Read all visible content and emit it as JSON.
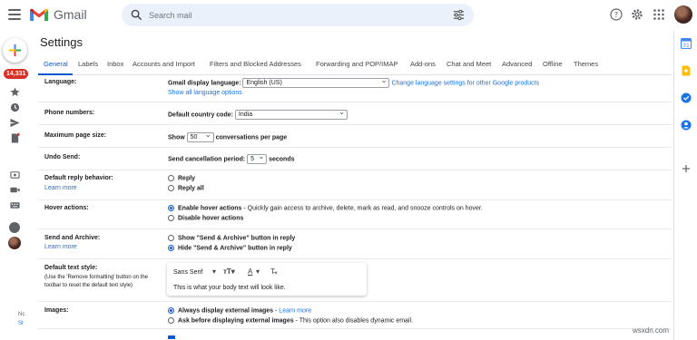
{
  "app": {
    "brand": "Gmail",
    "search_placeholder": "Search mail",
    "unread_badge": "14,331"
  },
  "settings": {
    "title": "Settings",
    "tabs": [
      "General",
      "Labels",
      "Inbox",
      "Accounts and Import",
      "Filters and Blocked Addresses",
      "Forwarding and POP/IMAP",
      "Add-ons",
      "Chat and Meet",
      "Advanced",
      "Offline",
      "Themes"
    ],
    "active_tab": "General",
    "language": {
      "label": "Language:",
      "prompt": "Gmail display language:",
      "value": "English (US)",
      "link": "Change language settings for other Google products",
      "show_all": "Show all language options"
    },
    "phone": {
      "label": "Phone numbers:",
      "prompt": "Default country code:",
      "value": "India"
    },
    "page_size": {
      "label": "Maximum page size:",
      "prefix": "Show",
      "value": "50",
      "suffix": "conversations per page"
    },
    "undo_send": {
      "label": "Undo Send:",
      "prompt": "Send cancellation period:",
      "value": "5",
      "suffix": "seconds"
    },
    "reply": {
      "label": "Default reply behavior:",
      "learn_more": "Learn more",
      "options": [
        "Reply",
        "Reply all"
      ],
      "selected": ""
    },
    "hover": {
      "label": "Hover actions:",
      "enable_bold": "Enable hover actions",
      "enable_desc": " - Quickly gain access to archive, delete, mark as read, and snooze controls on hover.",
      "disable": "Disable hover actions",
      "selected": "enable"
    },
    "send_archive": {
      "label": "Send and Archive:",
      "learn_more": "Learn more",
      "show": "Show \"Send & Archive\" button in reply",
      "hide": "Hide \"Send & Archive\" button in reply",
      "selected": "hide"
    },
    "text_style": {
      "label": "Default text style:",
      "note": "(Use the 'Remove formatting' button on the toolbar to reset the default text style)",
      "font": "Sans Serif",
      "preview": "This is what your body text will look like."
    },
    "images": {
      "label": "Images:",
      "always_bold": "Always display external images",
      "always_link": "Learn more",
      "ask_bold": "Ask before displaying external images",
      "ask_desc": " - This option also disables dynamic email.",
      "selected": "always"
    }
  },
  "rail_bottom": [
    "Nc",
    "St"
  ],
  "watermark": "wsxdn.com",
  "colors": {
    "accent": "#0b57d0",
    "link": "#1a73e8",
    "badge": "#d93025",
    "search_bg": "#eaf1fb"
  }
}
